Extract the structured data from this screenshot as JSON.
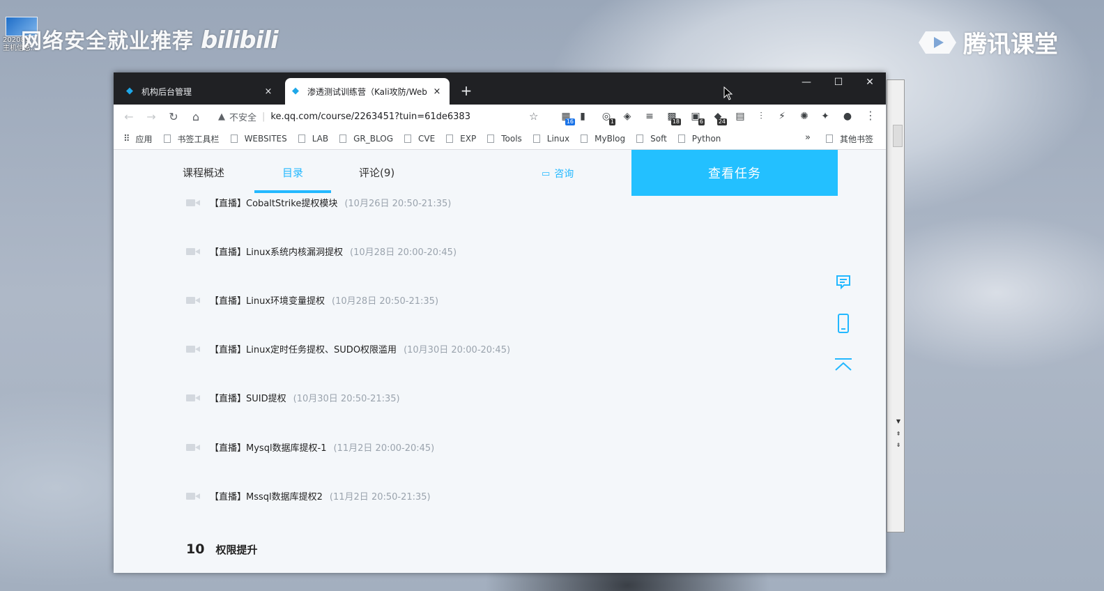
{
  "desktop": {
    "icon_label_1": "202081",
    "icon_label_2": "主机信息...",
    "watermark_left": "网络安全就业推荐",
    "watermark_bili": "bilibili",
    "watermark_right": "腾讯课堂"
  },
  "browser": {
    "tabs": [
      {
        "title": "机构后台管理",
        "close": "×"
      },
      {
        "title": "渗透测试训练营（Kali攻防/Web",
        "close": "×"
      }
    ],
    "new_tab": "+",
    "window_controls": {
      "minimize": "—",
      "maximize": "☐",
      "close": "✕"
    },
    "address": {
      "security_label": "不安全",
      "url": "ke.qq.com/course/2263451?tuin=61de6383"
    },
    "extension_badges": {
      "ext1": "16",
      "ext2": "1",
      "ext3": "6",
      "ext4": "24",
      "ext5": "18"
    },
    "bookmarks": [
      {
        "label": "应用"
      },
      {
        "label": "书签工具栏"
      },
      {
        "label": "WEBSITES"
      },
      {
        "label": "LAB"
      },
      {
        "label": "GR_BLOG"
      },
      {
        "label": "CVE"
      },
      {
        "label": "EXP"
      },
      {
        "label": "Tools"
      },
      {
        "label": "Linux"
      },
      {
        "label": "MyBlog"
      },
      {
        "label": "Soft"
      },
      {
        "label": "Python"
      }
    ],
    "bookmarks_more": "»",
    "other_bookmarks": "其他书签"
  },
  "course_page": {
    "tabs": [
      {
        "label": "课程概述",
        "active": false
      },
      {
        "label": "目录",
        "active": true
      },
      {
        "label": "评论(9)",
        "active": false
      }
    ],
    "consult_label": "咨询",
    "view_tasks_label": "查看任务",
    "accent_color": "#23b8ff",
    "lessons": [
      {
        "tag": "【直播】",
        "title": "CobaltStrike提权模块",
        "time": "(10月26日 20:50-21:35)"
      },
      {
        "tag": "【直播】",
        "title": "Linux系统内核漏洞提权",
        "time": "(10月28日 20:00-20:45)"
      },
      {
        "tag": "【直播】",
        "title": "Linux环境变量提权",
        "time": "(10月28日 20:50-21:35)"
      },
      {
        "tag": "【直播】",
        "title": "Linux定时任务提权、SUDO权限滥用",
        "time": "(10月30日 20:00-20:45)"
      },
      {
        "tag": "【直播】",
        "title": "SUID提权",
        "time": "(10月30日 20:50-21:35)"
      },
      {
        "tag": "【直播】",
        "title": "Mysql数据库提权-1",
        "time": "(11月2日 20:00-20:45)"
      },
      {
        "tag": "【直播】",
        "title": "Mssql数据库提权2",
        "time": "(11月2日 20:50-21:35)"
      }
    ],
    "chapter": {
      "number": "10",
      "title": "权限提升"
    },
    "float_tools": [
      {
        "icon": "message-icon"
      },
      {
        "icon": "mobile-icon"
      },
      {
        "icon": "back-to-top-icon"
      }
    ]
  }
}
